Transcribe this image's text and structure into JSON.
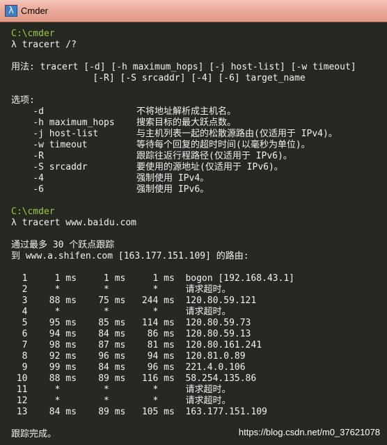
{
  "window": {
    "title": "Cmder",
    "icon": "lambda-icon",
    "icon_glyph": "λ"
  },
  "console": {
    "lines": [
      {
        "text": "C:\\cmder",
        "style": "prompt",
        "row": 0
      },
      {
        "text": "λ tracert /?",
        "style": "text",
        "row": 1
      },
      {
        "text": "用法: tracert [-d] [-h maximum_hops] [-j host-list] [-w timeout]",
        "style": "text",
        "row": 3
      },
      {
        "text": "               [-R] [-S srcaddr] [-4] [-6] target_name",
        "style": "text",
        "row": 4
      },
      {
        "text": "选项:",
        "style": "text",
        "row": 6
      },
      {
        "text": "    -d                 不将地址解析成主机名。",
        "style": "text",
        "row": 7
      },
      {
        "text": "    -h maximum_hops    搜索目标的最大跃点数。",
        "style": "text",
        "row": 8
      },
      {
        "text": "    -j host-list       与主机列表一起的松散源路由(仅适用于 IPv4)。",
        "style": "text",
        "row": 9
      },
      {
        "text": "    -w timeout         等待每个回复的超时时间(以毫秒为单位)。",
        "style": "text",
        "row": 10
      },
      {
        "text": "    -R                 跟踪往返行程路径(仅适用于 IPv6)。",
        "style": "text",
        "row": 11
      },
      {
        "text": "    -S srcaddr         要使用的源地址(仅适用于 IPv6)。",
        "style": "text",
        "row": 12
      },
      {
        "text": "    -4                 强制使用 IPv4。",
        "style": "text",
        "row": 13
      },
      {
        "text": "    -6                 强制使用 IPv6。",
        "style": "text",
        "row": 14
      },
      {
        "text": "C:\\cmder",
        "style": "prompt",
        "row": 16
      },
      {
        "text": "λ tracert www.baidu.com",
        "style": "text",
        "row": 17
      },
      {
        "text": "通过最多 30 个跃点跟踪",
        "style": "text",
        "row": 19
      },
      {
        "text": "到 www.a.shifen.com [163.177.151.109] 的路由:",
        "style": "text",
        "row": 20
      },
      {
        "text": "  1     1 ms     1 ms     1 ms  bogon [192.168.43.1]",
        "style": "text",
        "row": 22
      },
      {
        "text": "  2     *        *        *     请求超时。",
        "style": "text",
        "row": 23
      },
      {
        "text": "  3    88 ms    75 ms   244 ms  120.80.59.121",
        "style": "text",
        "row": 24
      },
      {
        "text": "  4     *        *        *     请求超时。",
        "style": "text",
        "row": 25
      },
      {
        "text": "  5    95 ms    85 ms   114 ms  120.80.59.73",
        "style": "text",
        "row": 26
      },
      {
        "text": "  6    94 ms    84 ms    86 ms  120.80.59.13",
        "style": "text",
        "row": 27
      },
      {
        "text": "  7    98 ms    87 ms    81 ms  120.80.161.241",
        "style": "text",
        "row": 28
      },
      {
        "text": "  8    92 ms    96 ms    94 ms  120.81.0.89",
        "style": "text",
        "row": 29
      },
      {
        "text": "  9    99 ms    84 ms    96 ms  221.4.0.106",
        "style": "text",
        "row": 30
      },
      {
        "text": " 10    88 ms    89 ms   116 ms  58.254.135.86",
        "style": "text",
        "row": 31
      },
      {
        "text": " 11     *        *        *     请求超时。",
        "style": "text",
        "row": 32
      },
      {
        "text": " 12     *        *        *     请求超时。",
        "style": "text",
        "row": 33
      },
      {
        "text": " 13    84 ms    89 ms   105 ms  163.177.151.109",
        "style": "text",
        "row": 34
      },
      {
        "text": "跟踪完成。",
        "style": "text",
        "row": 36
      }
    ]
  },
  "watermark": "https://blog.csdn.net/m0_37621078"
}
